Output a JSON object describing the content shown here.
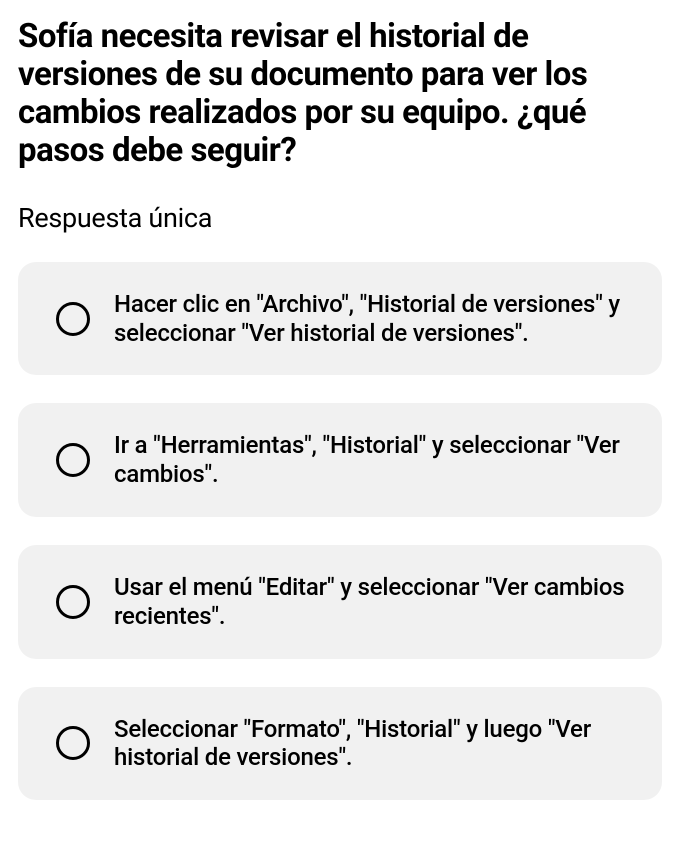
{
  "question": {
    "title": "Sofía necesita revisar el historial de versiones de su documento para ver los cambios realizados por su equipo. ¿qué pasos debe seguir?",
    "subtitle": "Respuesta única"
  },
  "options": [
    {
      "text": "Hacer clic en \"Archivo\", \"Historial de versiones\" y seleccionar \"Ver historial de versiones\"."
    },
    {
      "text": "Ir a \"Herramientas\", \"Historial\" y seleccionar \"Ver cambios\"."
    },
    {
      "text": "Usar el menú \"Editar\" y seleccionar \"Ver cambios recientes\"."
    },
    {
      "text": "Seleccionar \"Formato\", \"Historial\" y luego \"Ver historial de versiones\"."
    }
  ]
}
